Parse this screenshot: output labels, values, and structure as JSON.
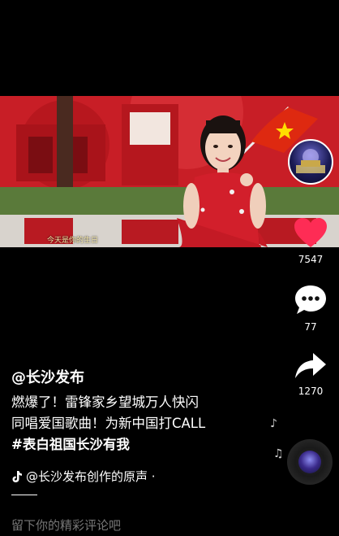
{
  "video": {
    "caption": "今天是你的生日"
  },
  "actions": {
    "like_count": "7547",
    "comment_count": "77",
    "share_count": "1270"
  },
  "post": {
    "author": "@长沙发布",
    "description_line1": "燃爆了！雷锋家乡望城万人快闪",
    "description_line2": "同唱爱国歌曲！为新中国打CALL",
    "hashtag": "#表白祖国长沙有我",
    "music": "@长沙发布创作的原声 ·"
  },
  "comment_bar": {
    "placeholder": "留下你的精彩评论吧"
  },
  "colors": {
    "like": "#fe2c55",
    "flag": "#de2910",
    "dress": "#d21f2b"
  }
}
